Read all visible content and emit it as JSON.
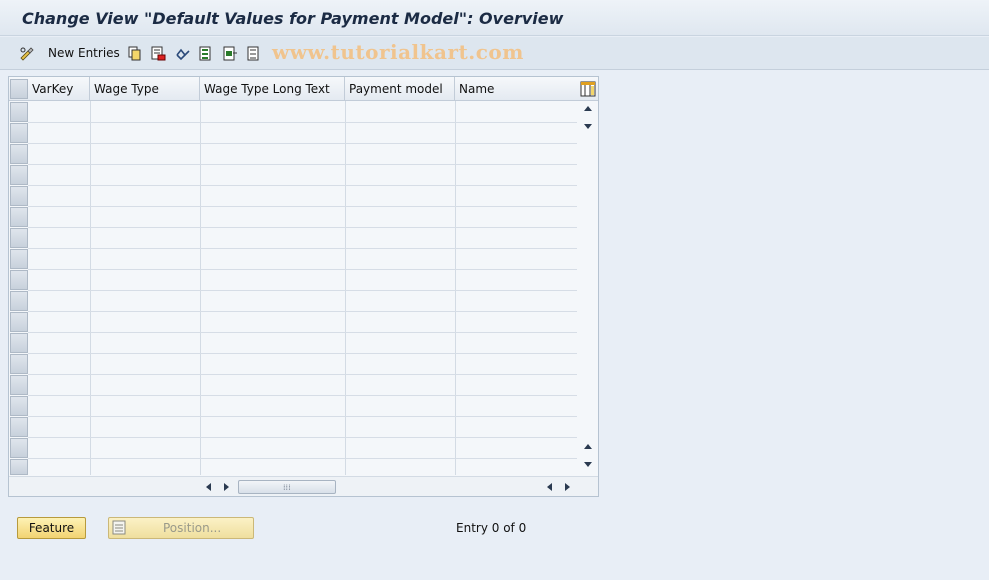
{
  "window": {
    "title": "Change View \"Default Values for Payment Model\": Overview"
  },
  "toolbar": {
    "new_entries_label": "New Entries",
    "icons": [
      "edit-glasses-icon",
      "copy-icon",
      "delete-icon",
      "undo-icon",
      "select-all-icon",
      "select-block-icon",
      "deselect-all-icon"
    ],
    "watermark": "www.tutorialkart.com"
  },
  "table": {
    "columns": [
      "VarKey",
      "Wage Type",
      "Wage Type Long Text",
      "Payment model",
      "Name"
    ],
    "rows": [],
    "config_icon": "table-settings-icon"
  },
  "footer": {
    "feature_label": "Feature",
    "position_label": "Position...",
    "entry_status": "Entry 0 of 0"
  },
  "colors": {
    "title_bar": "#dfe7f0",
    "toolbar": "#dde6ef",
    "background": "#e8eef6",
    "button_yellow": "#f2d372",
    "watermark": "#f0c48e"
  }
}
